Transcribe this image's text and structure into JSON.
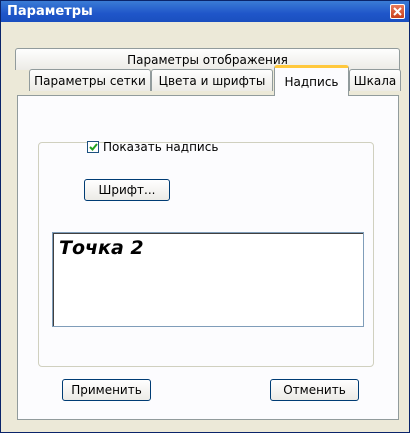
{
  "window": {
    "title": "Параметры"
  },
  "tabs": {
    "row_top": [
      {
        "label": "Параметры отображения"
      }
    ],
    "row_bottom": [
      {
        "label": "Параметры сетки"
      },
      {
        "label": "Цвета и шрифты"
      },
      {
        "label": "Надпись",
        "active": true
      },
      {
        "label": "Шкала"
      }
    ]
  },
  "caption_tab": {
    "show_caption": {
      "label": "Показать надпись",
      "checked": true
    },
    "font_button": "Шрифт...",
    "preview_text": "Точка 2"
  },
  "footer": {
    "apply": "Применить",
    "cancel": "Отменить"
  },
  "colors": {
    "titlebar": "#1f56c9",
    "active_tab_accent": "#ffc83c",
    "window_bg": "#ece9d8"
  },
  "icons": {
    "close": "close-icon",
    "check": "checkmark-icon"
  }
}
